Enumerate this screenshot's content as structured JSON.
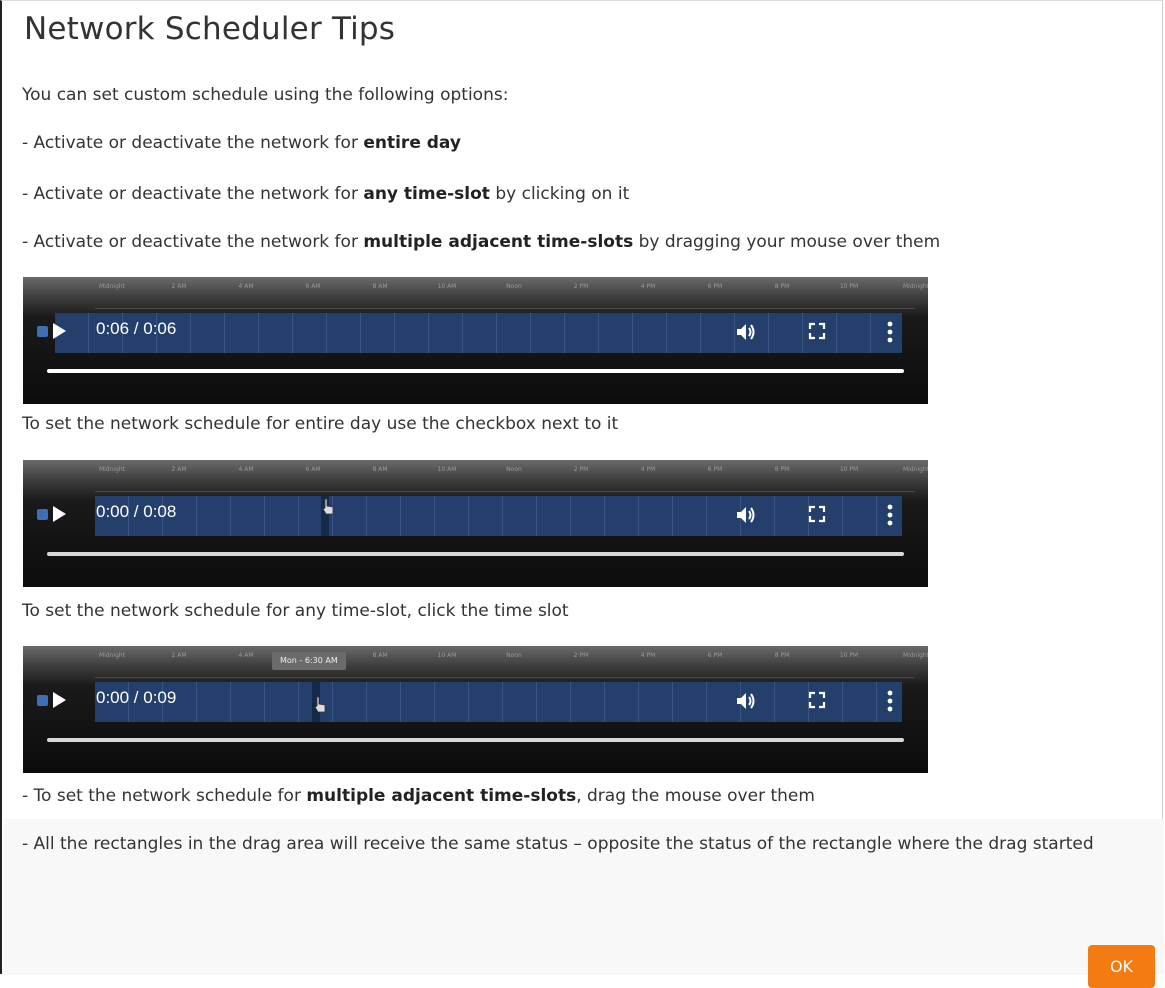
{
  "dialog": {
    "title": "Network Scheduler Tips",
    "intro": "You can set custom schedule using the following options:",
    "bullets": [
      {
        "prefix": "- Activate or deactivate the network for ",
        "bold": "entire day",
        "suffix": ""
      },
      {
        "prefix": "- Activate or deactivate the network for ",
        "bold": "any time-slot",
        "suffix": " by clicking on it"
      },
      {
        "prefix": "- Activate or deactivate the network for ",
        "bold": "multiple adjacent time-slots",
        "suffix": " by dragging your mouse over them"
      }
    ],
    "schedule_hours": [
      "Midnight",
      "2 AM",
      "4 AM",
      "6 AM",
      "8 AM",
      "10 AM",
      "Noon",
      "2 PM",
      "4 PM",
      "6 PM",
      "8 PM",
      "10 PM",
      "Midnight"
    ],
    "videos": [
      {
        "time_display": "0:06 / 0:06",
        "caption": "To set the network schedule for entire day use the checkbox next to it",
        "progress": 1.0
      },
      {
        "time_display": "0:00 / 0:08",
        "caption": "To set the network schedule for any time-slot, click the time slot",
        "progress": 0.0
      },
      {
        "time_display": "0:00 / 0:09",
        "caption": "",
        "progress": 0.0,
        "tooltip": "Mon - 6:30 AM"
      }
    ],
    "drag_note": {
      "prefix": "- To set the network schedule for ",
      "bold": "multiple adjacent time-slots",
      "suffix": ", drag the mouse over them"
    },
    "rect_note": "- All the rectangles in the drag area will receive the same status – opposite the status of the rectangle where the drag started",
    "ok_label": "OK"
  },
  "colors": {
    "accent_button": "#f47b12",
    "schedule_band": "#253f6d",
    "checkbox": "#3d6fb6"
  },
  "icons": {
    "play": "play-icon",
    "volume": "volume-icon",
    "fullscreen": "fullscreen-icon",
    "more": "more-vertical-icon"
  }
}
